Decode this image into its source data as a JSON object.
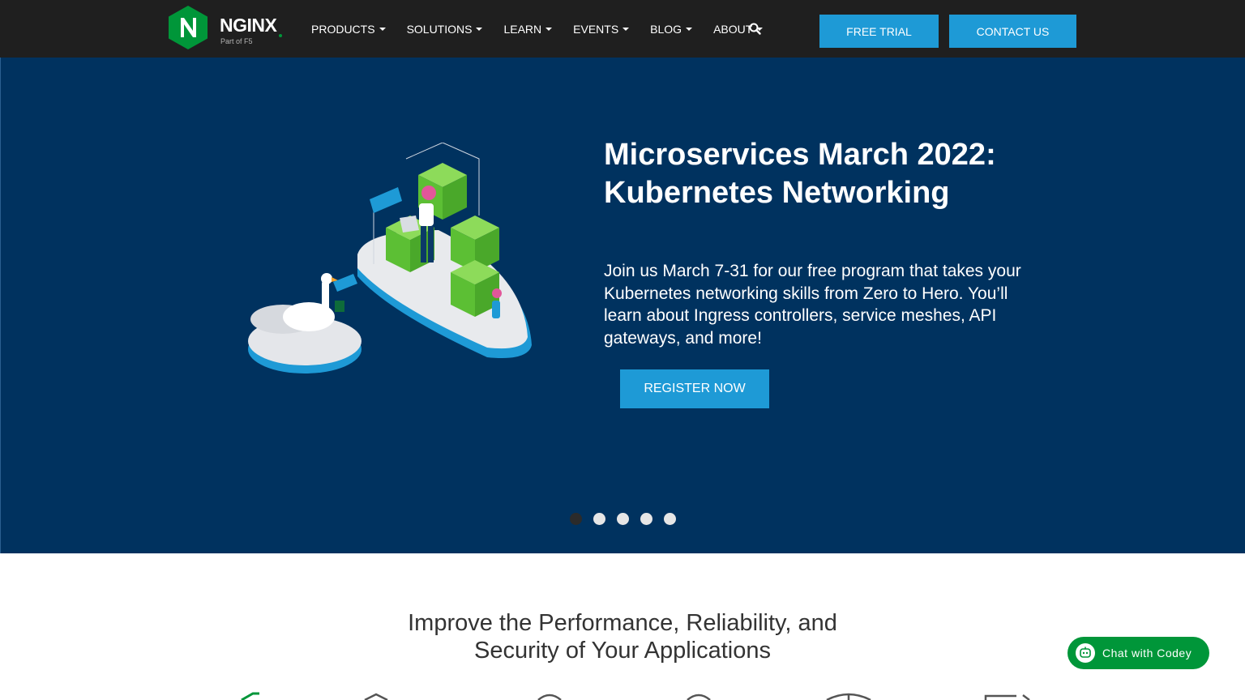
{
  "header": {
    "logo_text": "NGINX",
    "logo_subtext": "Part of F5",
    "nav": [
      {
        "label": "PRODUCTS"
      },
      {
        "label": "SOLUTIONS"
      },
      {
        "label": "LEARN"
      },
      {
        "label": "EVENTS"
      },
      {
        "label": "BLOG"
      },
      {
        "label": "ABOUT"
      }
    ],
    "search_icon": "search-icon",
    "free_trial_label": "FREE TRIAL",
    "contact_label": "CONTACT US"
  },
  "hero": {
    "title": "Microservices March 2022: Kubernetes Networking",
    "description": "Join us March 7-31 for our free program that takes your Kubernetes networking skills from Zero to Hero. You’ll learn about Ingress controllers, service meshes, API gateways, and more!",
    "cta_label": "REGISTER NOW",
    "slides_count": 5,
    "active_slide": 1
  },
  "section": {
    "title_line1": "Improve the Performance, Reliability, and",
    "title_line2": "Security of Your Applications"
  },
  "chat": {
    "label": "Chat with Codey",
    "icon": "chat-bot-icon"
  },
  "colors": {
    "topbar": "#1f1f1f",
    "hero_bg": "#00325f",
    "accent_blue": "#1e9ad6",
    "brand_green": "#009639"
  }
}
